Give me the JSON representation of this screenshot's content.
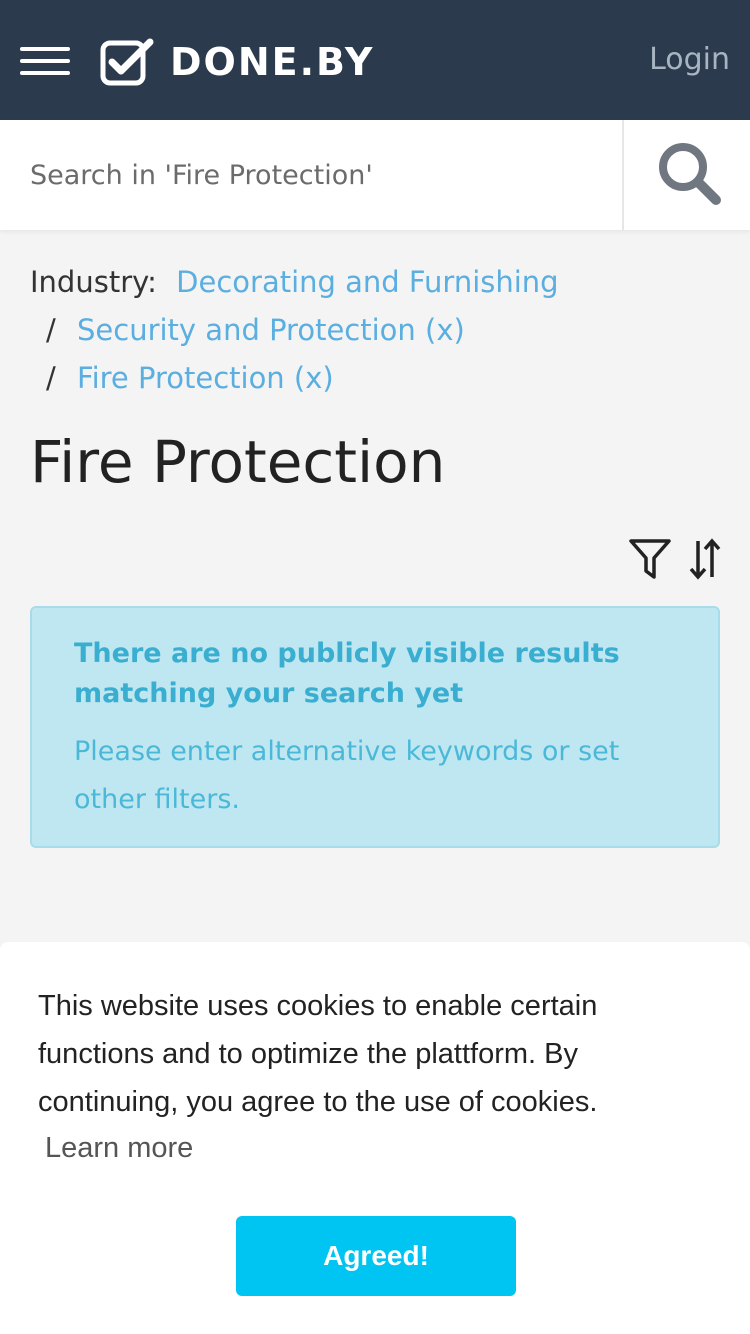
{
  "header": {
    "menu_icon": "hamburger-menu-icon",
    "logo_icon": "checkbox-check-icon",
    "logo_text": "DONE.BY",
    "login_label": "Login",
    "background_color": "#2b3a4d"
  },
  "search": {
    "placeholder": "Search in 'Fire Protection'",
    "value": "",
    "button_icon": "search-icon"
  },
  "breadcrumb": {
    "label": "Industry:",
    "items": [
      {
        "label": "Decorating and Furnishing"
      },
      {
        "label": "Security and Protection (x)"
      },
      {
        "label": "Fire Protection (x)"
      }
    ],
    "separator": "/",
    "link_color": "#5aaee0"
  },
  "page": {
    "title": "Fire Protection",
    "filter_icon": "funnel-filter-icon",
    "sort_icon": "sort-arrows-icon"
  },
  "alert": {
    "title": "There are no publicly visible results matching your search yet",
    "text": "Please enter alternative keywords or set other filters.",
    "background_color": "#bfe7f1"
  },
  "cookie_banner": {
    "text": "This website uses cookies to enable certain functions and to optimize the plattform. By continuing, you agree to the use of cookies.",
    "learn_more_label": "Learn more",
    "agree_label": "Agreed!",
    "button_color": "#00c4f2"
  }
}
